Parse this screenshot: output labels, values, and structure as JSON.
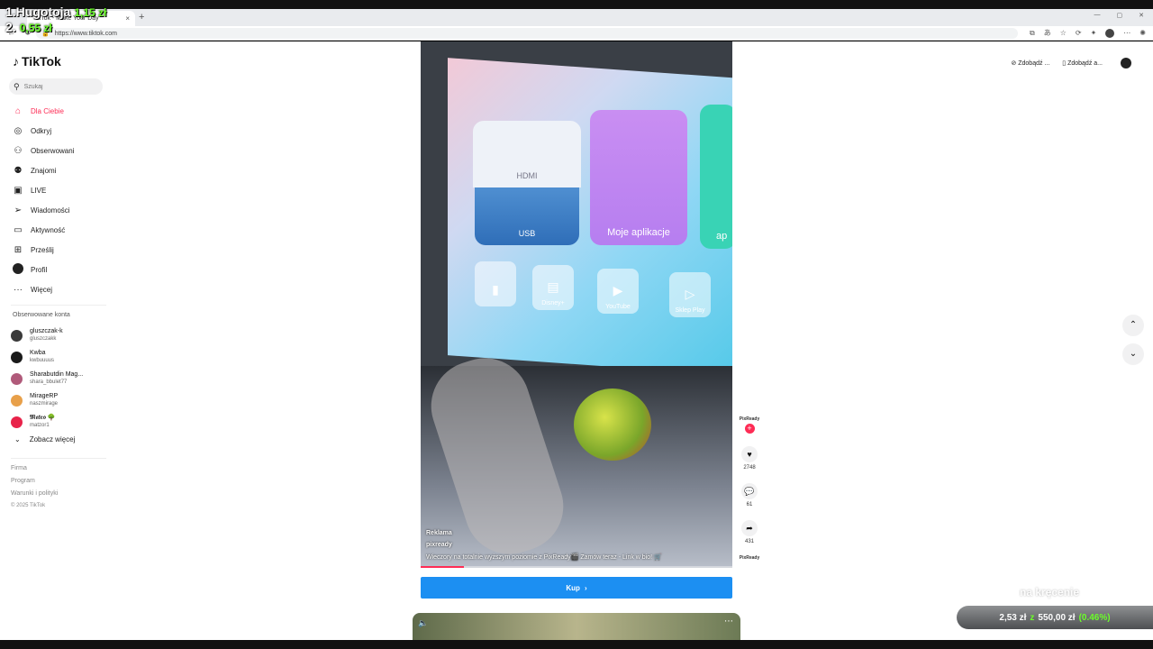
{
  "overlay": {
    "line1_label": "1.Hugotoja",
    "line1_value": "1,15 zł",
    "line2_label": "2.",
    "line2_value": "0,55 zł"
  },
  "browser": {
    "tab_title": "TikTok - Make Your Day",
    "tab_close": "×",
    "new_tab": "+",
    "url": "https://www.tiktok.com",
    "minimize": "—",
    "maximize": "▢",
    "close": "✕"
  },
  "sidebar": {
    "logo": "TikTok",
    "search_placeholder": "Szukaj",
    "nav": [
      {
        "label": "Dla Ciebie",
        "icon": "home-icon",
        "glyph": "⌂"
      },
      {
        "label": "Odkryj",
        "icon": "compass-icon",
        "glyph": "◎"
      },
      {
        "label": "Obserwowani",
        "icon": "user-plus-icon",
        "glyph": "⚇"
      },
      {
        "label": "Znajomi",
        "icon": "friends-icon",
        "glyph": "⚉"
      },
      {
        "label": "LIVE",
        "icon": "live-icon",
        "glyph": "▣"
      },
      {
        "label": "Wiadomości",
        "icon": "paper-plane-icon",
        "glyph": "➢"
      },
      {
        "label": "Aktywność",
        "icon": "activity-icon",
        "glyph": "▭"
      },
      {
        "label": "Prześlij",
        "icon": "upload-icon",
        "glyph": "⊞"
      },
      {
        "label": "Profil",
        "icon": "profile-icon",
        "glyph": ""
      },
      {
        "label": "Więcej",
        "icon": "more-icon",
        "glyph": "···"
      }
    ],
    "followed_title": "Obserwowane konta",
    "accounts": [
      {
        "name": "gluszczak-k",
        "handle": "gluszczakk",
        "color": "#3a3a3a"
      },
      {
        "name": "Kwba",
        "handle": "kwbuuuus",
        "color": "#1a1a1a"
      },
      {
        "name": "Sharabutdin Mag...",
        "handle": "shara_bbulet77",
        "color": "#b05a7a"
      },
      {
        "name": "MirageRP",
        "handle": "naszmirage",
        "color": "#e8a04a"
      },
      {
        "name": "𝕸𝖆𝖙𝖊𝖔 🌳",
        "handle": "matzor1",
        "color": "#e8234a"
      }
    ],
    "see_more": "Zobacz więcej",
    "footer": [
      "Firma",
      "Program",
      "Warunki i polityki"
    ],
    "copyright": "© 2025 TikTok"
  },
  "header": {
    "get_coins": "Zdobądź ...",
    "get_app": "Zdobądź a..."
  },
  "video": {
    "tiles": {
      "hdmi": "HDMI",
      "usb": "USB",
      "apps": "Moje aplikacje",
      "ap2": "ap"
    },
    "icons": [
      {
        "label": "",
        "glyph": "▮"
      },
      {
        "label": "Disney+",
        "glyph": "▤"
      },
      {
        "label": "YouTube",
        "glyph": "▶"
      },
      {
        "label": "Sklep Play",
        "glyph": "▷"
      }
    ],
    "ad_label": "Reklama",
    "username": "pixready",
    "description": "Wieczory na totalnie wyższym poziomie z PixReady🎬 Zamów teraz - Link w bio! 🛒",
    "progress": 0.14
  },
  "actions": {
    "brand": "PixReady",
    "likes": "2748",
    "comments": "61",
    "shares": "431",
    "brand_bottom": "PixReady"
  },
  "buy_label": "Kup",
  "stream": {
    "watermark": "na kręcenie",
    "current": "2,53 zł",
    "of": "z",
    "goal": "550,00 zł",
    "percent": "(0.46%)"
  }
}
